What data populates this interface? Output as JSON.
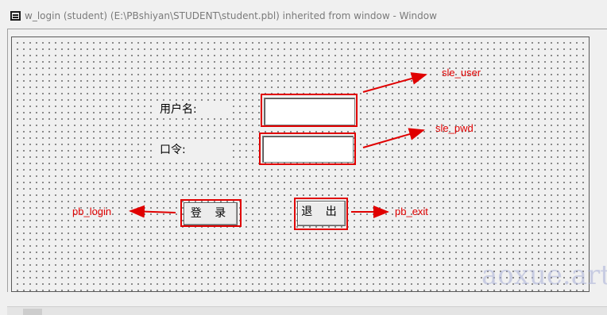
{
  "window": {
    "title": "w_login (student) (E:\\PBshiyan\\STUDENT\\student.pbl) inherited from window - Window"
  },
  "form": {
    "user_label": "用户名:",
    "password_label": "口令:",
    "login_button": "登 录",
    "exit_button": "退 出"
  },
  "annotations": {
    "sle_user": "sle_user",
    "sle_pwd": "sle_pwd",
    "pb_login": "pb_login",
    "pb_exit": "pb_exit"
  },
  "watermark": "aoxue.art",
  "colors": {
    "annotation_red": "#e00000",
    "watermark": "#a8b0d8"
  },
  "icons": {
    "window_icon": "window-layout-icon",
    "arrows": "right-arrow / left-arrow"
  }
}
